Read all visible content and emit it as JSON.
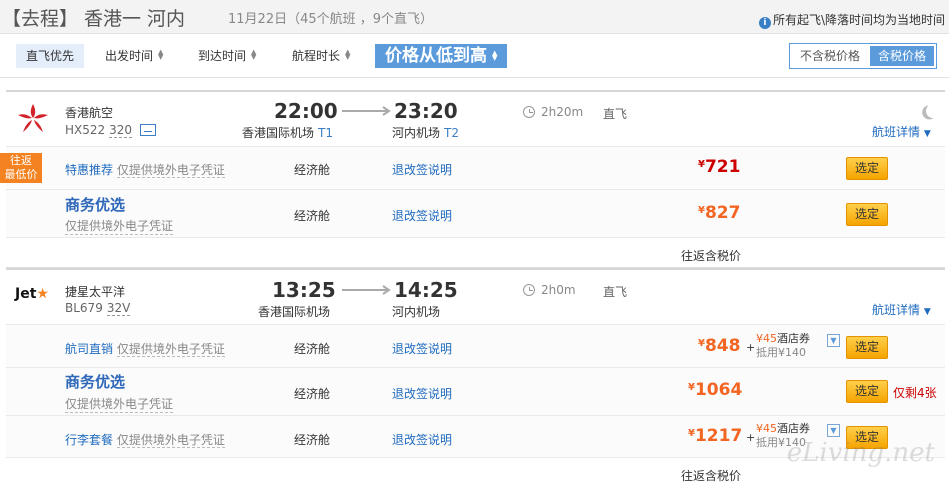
{
  "header": {
    "title_bracket": "【去程】",
    "route": "香港一 河内",
    "subtitle": "11月22日（45个航班 ，9个直飞）",
    "note": "所有起飞\\降落时间均为当地时间"
  },
  "sortbar": {
    "items": [
      "直飞优先",
      "出发时间",
      "到达时间",
      "航程时长"
    ],
    "price_sort": "价格从低到高",
    "tax_toggle": [
      "不含税价格",
      "含税价格"
    ]
  },
  "flights": [
    {
      "airline": "香港航空",
      "flight_no": "HX522",
      "plane": "320",
      "dep_time": "22:00",
      "dep_airport": "香港国际机场",
      "dep_terminal": "T1",
      "arr_time": "23:20",
      "arr_airport": "河内机场",
      "arr_terminal": "T2",
      "duration": "2h20m",
      "direct": "直飞",
      "details": "航班详情",
      "fares": [
        {
          "tag": "往返最低价",
          "name": "特惠推荐",
          "desc": "仅提供境外电子凭证",
          "cabin": "经济舱",
          "rule": "退改签说明",
          "yen": "¥",
          "price": "721",
          "select": "选定"
        },
        {
          "name": "商务优选",
          "desc": "仅提供境外电子凭证",
          "cabin": "经济舱",
          "rule": "退改签说明",
          "yen": "¥",
          "price": "827",
          "select": "选定"
        }
      ],
      "footer": "往返含税价"
    },
    {
      "airline": "捷星太平洋",
      "flight_no": "BL679",
      "plane": "32V",
      "dep_time": "13:25",
      "dep_airport": "香港国际机场",
      "arr_time": "14:25",
      "arr_airport": "河内机场",
      "duration": "2h0m",
      "direct": "直飞",
      "details": "航班详情",
      "fares": [
        {
          "name": "航司直销",
          "desc": "仅提供境外电子凭证",
          "cabin": "经济舱",
          "rule": "退改签说明",
          "yen": "¥",
          "price": "848",
          "plus": "+",
          "voucher_yen": "¥",
          "voucher_amt": "45",
          "voucher_label": "酒店券",
          "voucher_note": "抵用¥140",
          "select": "选定"
        },
        {
          "name": "商务优选",
          "desc": "仅提供境外电子凭证",
          "cabin": "经济舱",
          "rule": "退改签说明",
          "yen": "¥",
          "price": "1064",
          "select": "选定",
          "remain": "仅剩4张"
        },
        {
          "name": "行李套餐",
          "desc": "仅提供境外电子凭证",
          "cabin": "经济舱",
          "rule": "退改签说明",
          "yen": "¥",
          "price": "1217",
          "plus": "+",
          "voucher_yen": "¥",
          "voucher_amt": "45",
          "voucher_label": "酒店券",
          "voucher_note": "抵用¥140",
          "select": "选定"
        }
      ],
      "footer": "往返含税价"
    }
  ],
  "watermark": "eLiving.net",
  "colors": {
    "accent": "#5b9bdb",
    "price": "#f26522",
    "button": "#f5a400",
    "link": "#1f6bbf"
  }
}
